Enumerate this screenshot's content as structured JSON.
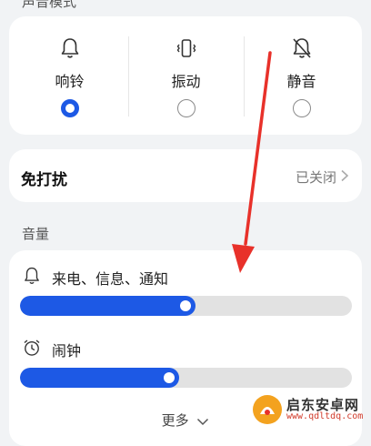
{
  "sound_mode": {
    "section_label": "声音模式",
    "options": [
      {
        "label": "响铃",
        "icon": "bell-icon",
        "selected": true
      },
      {
        "label": "振动",
        "icon": "vibrate-icon",
        "selected": false
      },
      {
        "label": "静音",
        "icon": "bell-off-icon",
        "selected": false
      }
    ]
  },
  "dnd": {
    "title": "免打扰",
    "status": "已关闭"
  },
  "volume": {
    "section_label": "音量",
    "rows": [
      {
        "label": "来电、信息、通知",
        "icon": "bell-icon",
        "level": 0.53
      },
      {
        "label": "闹钟",
        "icon": "alarm-clock-icon",
        "level": 0.48
      }
    ],
    "more_label": "更多"
  },
  "watermark": {
    "name": "启东安卓网",
    "url": "www.qdltdq.com"
  },
  "colors": {
    "accent": "#1d59e5",
    "arrow": "#e8312a",
    "background": "#f1f3f5"
  }
}
